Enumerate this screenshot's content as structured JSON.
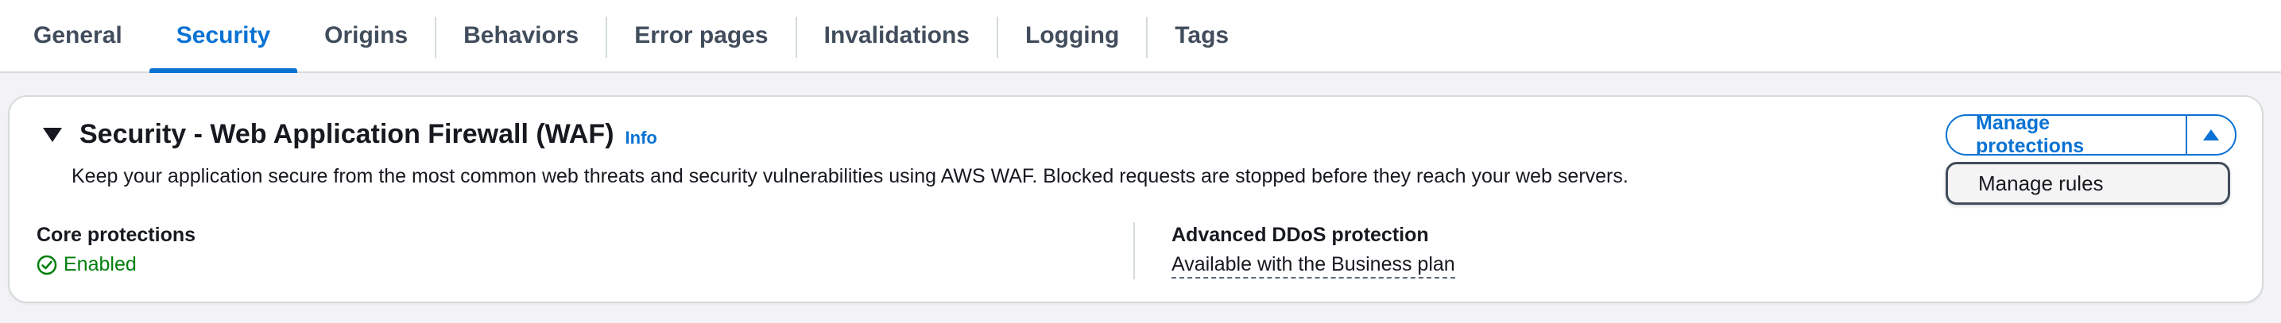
{
  "tabs": [
    {
      "label": "General",
      "active": false
    },
    {
      "label": "Security",
      "active": true
    },
    {
      "label": "Origins",
      "active": false
    },
    {
      "label": "Behaviors",
      "active": false
    },
    {
      "label": "Error pages",
      "active": false
    },
    {
      "label": "Invalidations",
      "active": false
    },
    {
      "label": "Logging",
      "active": false
    },
    {
      "label": "Tags",
      "active": false
    }
  ],
  "section": {
    "title": "Security - Web Application Firewall (WAF)",
    "info_label": "Info",
    "description": "Keep your application secure from the most common web threats and security vulnerabilities using AWS WAF. Blocked requests are stopped before they reach your web servers.",
    "expanded_icon": "caret-down-icon"
  },
  "core_protections": {
    "label": "Core protections",
    "status": "Enabled",
    "status_icon": "check-circle-icon",
    "status_color": "#037f0c"
  },
  "advanced_ddos": {
    "label": "Advanced DDoS protection",
    "value": "Available with the Business plan"
  },
  "actions": {
    "manage_protections_label": "Manage protections",
    "toggle_icon": "caret-up-icon",
    "menu_items": [
      {
        "label": "Manage rules"
      }
    ]
  },
  "colors": {
    "accent": "#0972d3",
    "success": "#037f0c",
    "text": "#16191f",
    "border": "#d5dbdb"
  }
}
